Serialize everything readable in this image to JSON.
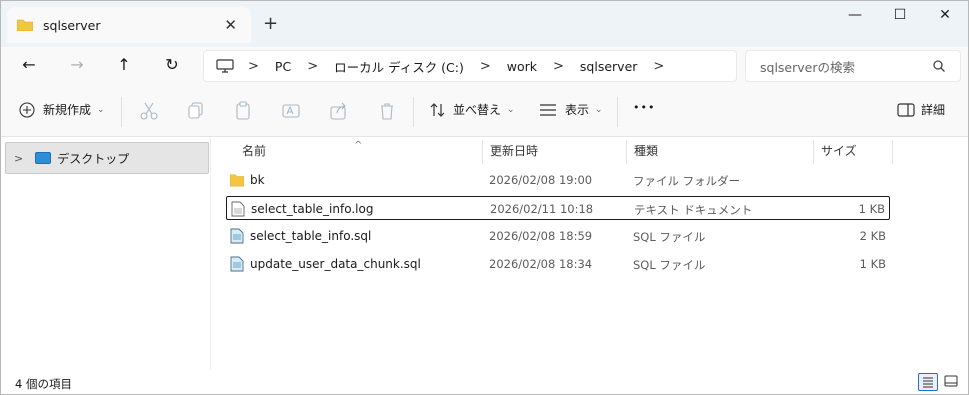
{
  "tab": {
    "title": "sqlserver",
    "close_glyph": "✕",
    "new_tab_glyph": "+"
  },
  "window_controls": {
    "minimize": "—",
    "maximize": "☐",
    "close": "✕"
  },
  "nav": {
    "back": "←",
    "forward": "→",
    "up": "↑",
    "refresh": "↻"
  },
  "breadcrumb": [
    {
      "label": "PC"
    },
    {
      "label": "ローカル ディスク (C:)"
    },
    {
      "label": "work"
    },
    {
      "label": "sqlserver"
    }
  ],
  "breadcrumb_sep": ">",
  "search": {
    "placeholder": "sqlserverの検索"
  },
  "toolbar": {
    "new_label": "新規作成",
    "sort_label": "並べ替え",
    "view_label": "表示",
    "more_label": "•••",
    "details_label": "詳細"
  },
  "sidebar": {
    "items": [
      {
        "label": "デスクトップ"
      }
    ]
  },
  "columns": {
    "name": "名前",
    "date": "更新日時",
    "type": "種類",
    "size": "サイズ"
  },
  "files": [
    {
      "name": "bk",
      "date": "2026/02/08 19:00",
      "type": "ファイル フォルダー",
      "size": "",
      "icon": "folder-icon"
    },
    {
      "name": "select_table_info.log",
      "date": "2026/02/11 10:18",
      "type": "テキスト ドキュメント",
      "size": "1 KB",
      "icon": "text-file-icon",
      "selected": true
    },
    {
      "name": "select_table_info.sql",
      "date": "2026/02/08 18:59",
      "type": "SQL ファイル",
      "size": "2 KB",
      "icon": "sql-file-icon"
    },
    {
      "name": "update_user_data_chunk.sql",
      "date": "2026/02/08 18:34",
      "type": "SQL ファイル",
      "size": "1 KB",
      "icon": "sql-file-icon"
    }
  ],
  "status": {
    "item_count": "4 個の項目"
  },
  "colors": {
    "folder": "#f4c542",
    "accent": "#2a6fc0",
    "selected_border": "#1a1a1a"
  }
}
